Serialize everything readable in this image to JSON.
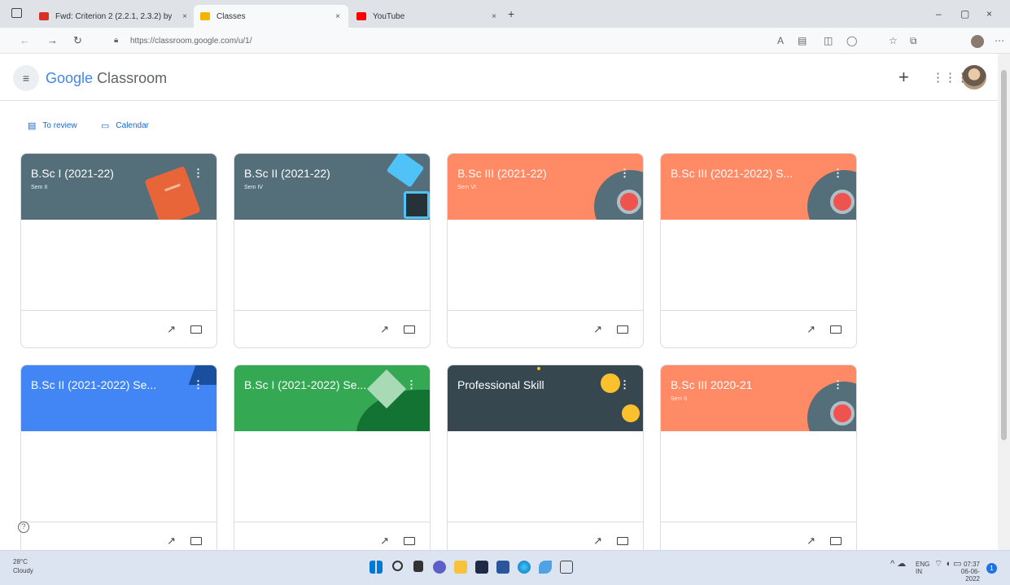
{
  "browser": {
    "tabs": [
      {
        "title": "Fwd: Criterion 2 (2.2.1, 2.3.2) by",
        "favicon_color": "#d93025"
      },
      {
        "title": "Classes",
        "favicon_color": "#f4b400"
      },
      {
        "title": "YouTube",
        "favicon_color": "#ff0000"
      }
    ],
    "url": "https://classroom.google.com/u/1/",
    "window_buttons": {
      "minimize": "–",
      "maximize": "▢",
      "close": "×"
    }
  },
  "header": {
    "brand_google": "Google",
    "brand_product": "Classroom",
    "add_label": "+"
  },
  "quick_links": {
    "to_review": "To review",
    "calendar": "Calendar"
  },
  "cards": [
    {
      "title": "B.Sc I (2021-22)",
      "subtitle": "Sem II",
      "color": "#546e7a",
      "icons": [
        "trending-icon",
        "folder-icon"
      ]
    },
    {
      "title": "B.Sc II (2021-22)",
      "subtitle": "Sem IV",
      "color": "#546e7a",
      "icons": [
        "trending-icon",
        "folder-icon"
      ]
    },
    {
      "title": "B.Sc III (2021-22)",
      "subtitle": "Sem VI",
      "color": "#ff8a65",
      "icons": [
        "trending-icon",
        "folder-icon"
      ]
    },
    {
      "title": "B.Sc III (2021-2022) S...",
      "subtitle": "",
      "color": "#ff8a65",
      "icons": [
        "trending-icon",
        "folder-icon"
      ]
    },
    {
      "title": "B.Sc II (2021-2022) Se...",
      "subtitle": "",
      "color": "#4285f4",
      "icons": [
        "trending-icon",
        "folder-icon"
      ]
    },
    {
      "title": "B.Sc I (2021-2022) Se...",
      "subtitle": "",
      "color": "#34a853",
      "icons": [
        "trending-icon",
        "folder-icon"
      ]
    },
    {
      "title": "Professional Skill",
      "subtitle": "",
      "color": "#37474f",
      "icons": [
        "trending-icon",
        "folder-icon"
      ]
    },
    {
      "title": "B.Sc III 2020-21",
      "subtitle": "Sem 6",
      "color": "#ff8a65",
      "icons": [
        "trending-icon",
        "folder-icon"
      ]
    }
  ],
  "taskbar": {
    "weather_temp": "28°C",
    "weather_desc": "Cloudy",
    "lang": "ENG",
    "lang_region": "IN",
    "time": "07:37",
    "date": "06-06-2022",
    "notifications": "1"
  }
}
